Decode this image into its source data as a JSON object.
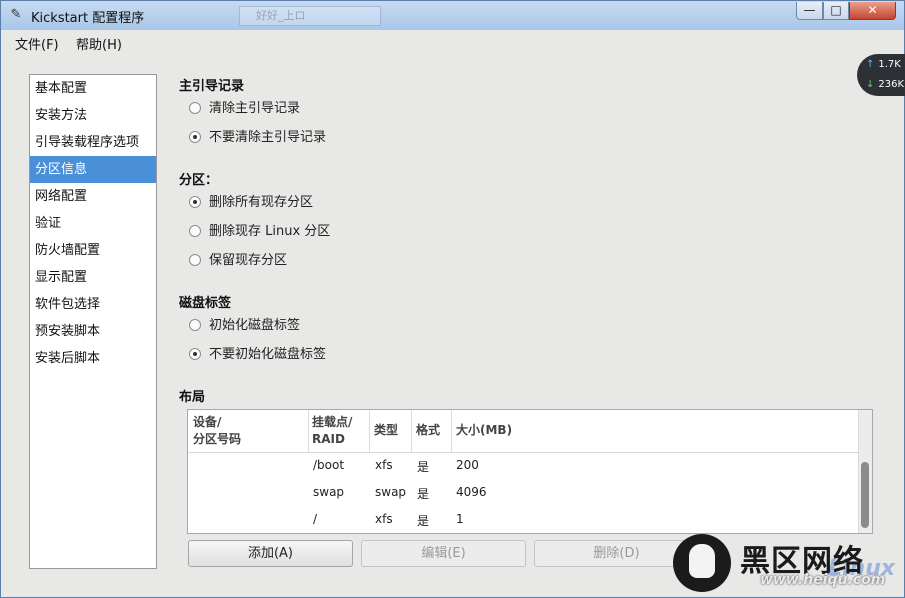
{
  "window": {
    "title": "Kickstart 配置程序",
    "ghost_text": "好好_上ロ",
    "buttons": {
      "minimize": "—",
      "maximize": "□",
      "close": "✕"
    }
  },
  "menu": [
    {
      "label": "文件(F)"
    },
    {
      "label": "帮助(H)"
    }
  ],
  "sidebar": {
    "selected_index": 3,
    "items": [
      {
        "label": "基本配置"
      },
      {
        "label": "安装方法"
      },
      {
        "label": "引导装载程序选项"
      },
      {
        "label": "分区信息"
      },
      {
        "label": "网络配置"
      },
      {
        "label": "验证"
      },
      {
        "label": "防火墙配置"
      },
      {
        "label": "显示配置"
      },
      {
        "label": "软件包选择"
      },
      {
        "label": "预安装脚本"
      },
      {
        "label": "安装后脚本"
      }
    ]
  },
  "mbr": {
    "title": "主引导记录",
    "options": [
      {
        "label": "清除主引导记录",
        "selected": false
      },
      {
        "label": "不要清除主引导记录",
        "selected": true
      }
    ]
  },
  "partitions": {
    "title": "分区：",
    "options": [
      {
        "label": "删除所有现存分区",
        "selected": true
      },
      {
        "label": "删除现存 Linux 分区",
        "selected": false
      },
      {
        "label": "保留现存分区",
        "selected": false
      }
    ]
  },
  "disklabel": {
    "title": "磁盘标签",
    "options": [
      {
        "label": "初始化磁盘标签",
        "selected": false
      },
      {
        "label": "不要初始化磁盘标签",
        "selected": true
      }
    ]
  },
  "layout": {
    "title": "布局",
    "headers": {
      "device_line1": "设备/",
      "device_line2": "分区号码",
      "mount_line1": "挂载点/",
      "mount_line2": "RAID",
      "type": "类型",
      "format": "格式",
      "size": "大小(MB)"
    },
    "rows": [
      {
        "device": "",
        "mount": "/boot",
        "type": "xfs",
        "format": "是",
        "size": "200"
      },
      {
        "device": "",
        "mount": "swap",
        "type": "swap",
        "format": "是",
        "size": "4096"
      },
      {
        "device": "",
        "mount": "/",
        "type": "xfs",
        "format": "是",
        "size": "1"
      }
    ],
    "buttons": {
      "add": "添加(A)",
      "edit": "编辑(E)",
      "delete": "删除(D)"
    }
  },
  "net_widget": {
    "upload": "1.7K",
    "download": "236K"
  },
  "watermark": {
    "name": "黑区网络",
    "url": "www.heiqu.com",
    "linux": "Linux"
  }
}
